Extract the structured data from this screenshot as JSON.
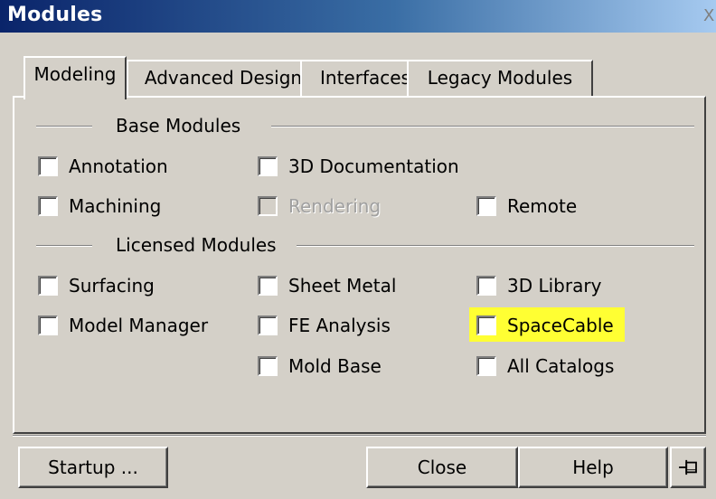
{
  "window": {
    "title": "Modules",
    "close_glyph": "X"
  },
  "tabs": [
    {
      "label": "Modeling",
      "active": true
    },
    {
      "label": "Advanced Design",
      "active": false
    },
    {
      "label": "Interfaces",
      "active": false
    },
    {
      "label": "Legacy Modules",
      "active": false
    }
  ],
  "groups": {
    "base": {
      "title": "Base Modules"
    },
    "licensed": {
      "title": "Licensed Modules"
    }
  },
  "modules": {
    "annotation": {
      "label": "Annotation",
      "checked": false,
      "enabled": true
    },
    "doc3d": {
      "label": "3D Documentation",
      "checked": false,
      "enabled": true
    },
    "machining": {
      "label": "Machining",
      "checked": false,
      "enabled": true
    },
    "rendering": {
      "label": "Rendering",
      "checked": false,
      "enabled": false
    },
    "remote": {
      "label": "Remote",
      "checked": false,
      "enabled": true
    },
    "surfacing": {
      "label": "Surfacing",
      "checked": false,
      "enabled": true
    },
    "sheet_metal": {
      "label": "Sheet Metal",
      "checked": false,
      "enabled": true
    },
    "library3d": {
      "label": "3D Library",
      "checked": false,
      "enabled": true
    },
    "model_manager": {
      "label": "Model Manager",
      "checked": false,
      "enabled": true
    },
    "fe_analysis": {
      "label": "FE Analysis",
      "checked": false,
      "enabled": true
    },
    "spacecable": {
      "label": "SpaceCable",
      "checked": false,
      "enabled": true,
      "highlighted": true
    },
    "mold_base": {
      "label": "Mold Base",
      "checked": false,
      "enabled": true
    },
    "all_catalogs": {
      "label": "All Catalogs",
      "checked": false,
      "enabled": true
    }
  },
  "buttons": {
    "startup": "Startup ...",
    "close": "Close",
    "help": "Help",
    "pin_icon": "pin-icon"
  },
  "colors": {
    "face": "#d4d0c8",
    "title_start": "#0a246a",
    "title_end": "#a6caf0",
    "highlight": "#ffff33",
    "disabled_text": "#a0a0a0"
  }
}
